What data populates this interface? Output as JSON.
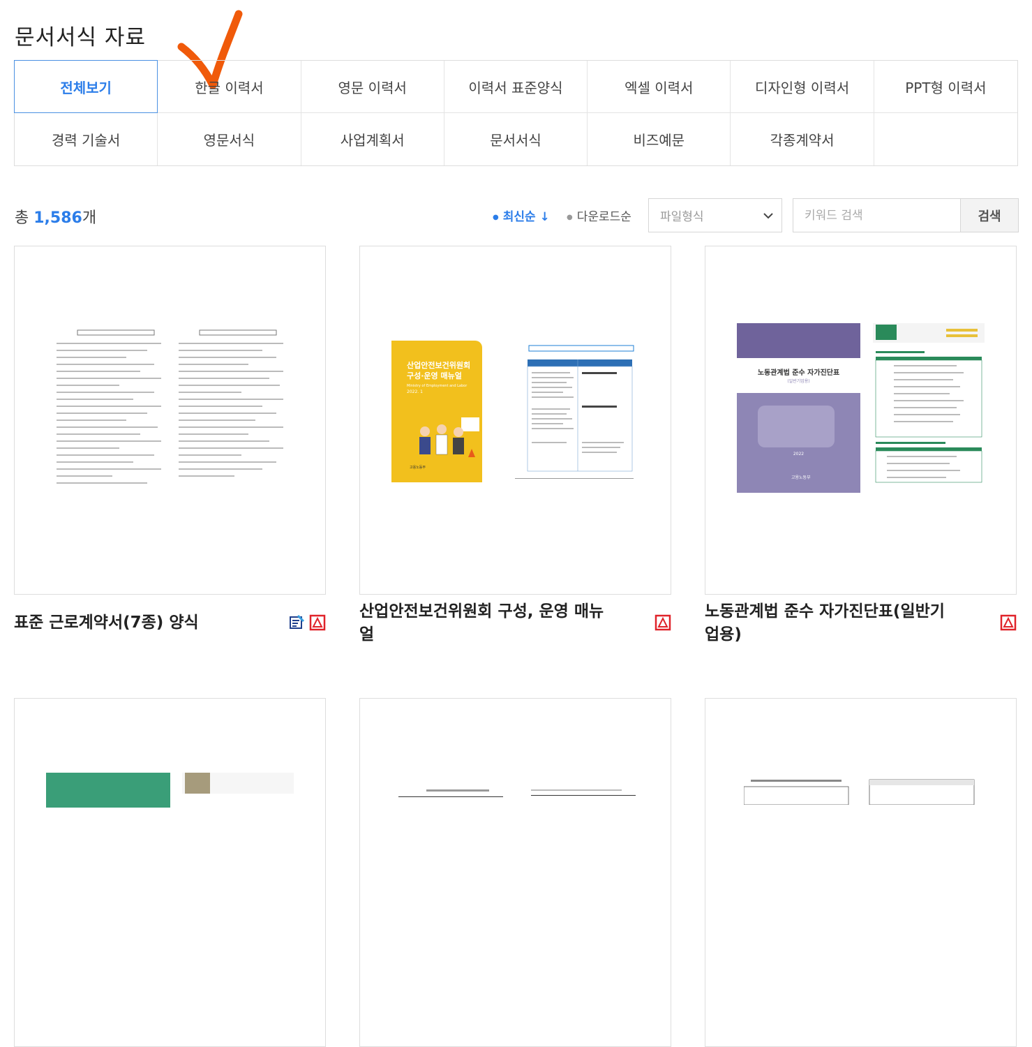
{
  "page_title": "문서서식 자료",
  "tabs": [
    {
      "label": "전체보기",
      "active": true
    },
    {
      "label": "한글 이력서"
    },
    {
      "label": "영문 이력서"
    },
    {
      "label": "이력서 표준양식"
    },
    {
      "label": "엑셀 이력서"
    },
    {
      "label": "디자인형 이력서"
    },
    {
      "label": "PPT형 이력서"
    },
    {
      "label": "경력 기술서"
    },
    {
      "label": "영문서식"
    },
    {
      "label": "사업계획서"
    },
    {
      "label": "문서서식"
    },
    {
      "label": "비즈예문"
    },
    {
      "label": "각종계약서"
    },
    {
      "label": ""
    }
  ],
  "summary": {
    "prefix": "총 ",
    "count": "1,586",
    "suffix": "개"
  },
  "sort": {
    "latest": "최신순 ↓",
    "download": "다운로드순"
  },
  "filter": {
    "file_type": "파일형식"
  },
  "search": {
    "placeholder": "키워드 검색",
    "button": "검색"
  },
  "cards": [
    {
      "title": "표준 근로계약서(7종) 양식",
      "icons": [
        "hwp-icon",
        "pdf-icon"
      ]
    },
    {
      "title": "산업안전보건위원회 구성, 운영 매뉴얼",
      "icons": [
        "pdf-icon"
      ],
      "cover": {
        "title": "산업안전보건위원회\n구성·운영 매뉴얼",
        "sub": "Ministry of Employment and Labor",
        "date": "2022. 1",
        "org": "고용노동부",
        "color": "#f2c01d"
      }
    },
    {
      "title": "노동관계법 준수 자가진단표(일반기업용)",
      "icons": [
        "pdf-icon"
      ],
      "cover": {
        "title": "노동관계법 준수 자가진단표",
        "sub": "(일반기업용)",
        "date": "2022",
        "org": "고용노동부",
        "color": "#8e86b5"
      }
    },
    {
      "title": "",
      "icons": []
    },
    {
      "title": "",
      "icons": []
    },
    {
      "title": "",
      "icons": []
    }
  ],
  "colors": {
    "accent": "#2b7de9",
    "check": "#f05a0a",
    "pdf": "#e0232a"
  }
}
